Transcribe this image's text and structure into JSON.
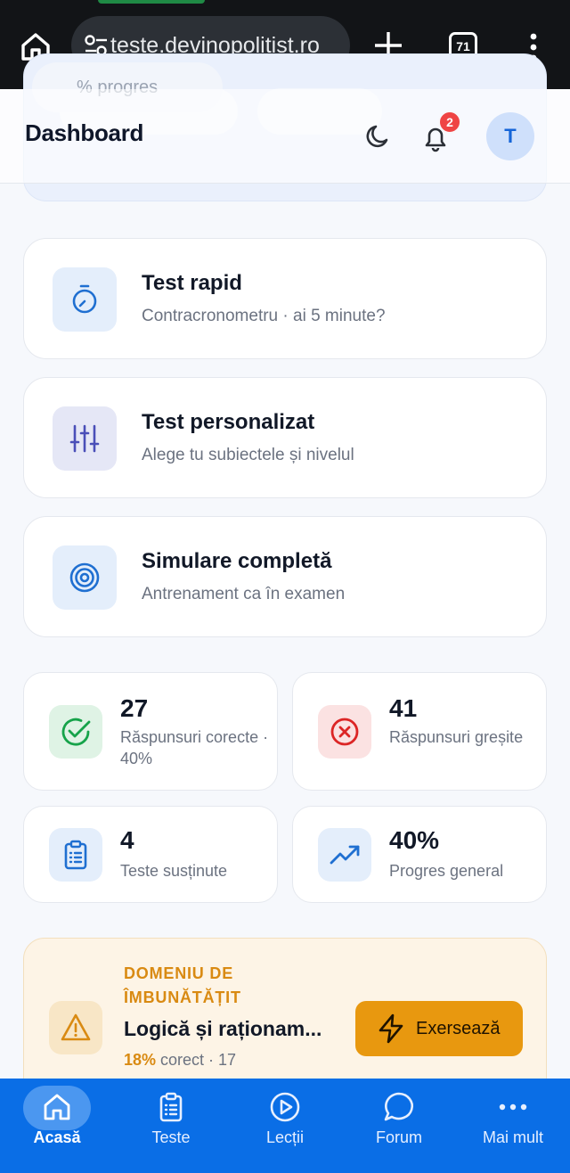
{
  "browser": {
    "url": "teste.devinopolitist.ro",
    "tab_count": "71"
  },
  "header": {
    "title": "Dashboard",
    "hero_progress_text": "% progres",
    "notification_count": "2",
    "avatar_initial": "T"
  },
  "actions": [
    {
      "title": "Test rapid",
      "subtitle": "Contracronometru · ai 5 minute?",
      "icon": "timer-icon",
      "color": "#1f6fd1"
    },
    {
      "title": "Test personalizat",
      "subtitle": "Alege tu subiectele și nivelul",
      "icon": "sliders-icon",
      "color": "#4a4fb8"
    },
    {
      "title": "Simulare completă",
      "subtitle": "Antrenament ca în examen",
      "icon": "target-icon",
      "color": "#1f6fd1"
    }
  ],
  "stats": [
    {
      "value": "27",
      "label": "Răspunsuri corecte · 40%",
      "icon": "check-circle-icon",
      "color": "#16a34a"
    },
    {
      "value": "41",
      "label": "Răspunsuri greșite",
      "icon": "x-circle-icon",
      "color": "#dc2626"
    },
    {
      "value": "4",
      "label": "Teste susținute",
      "icon": "clipboard-icon",
      "color": "#1f6fd1"
    },
    {
      "value": "40%",
      "label": "Progres general",
      "icon": "trending-up-icon",
      "color": "#1f6fd1"
    }
  ],
  "improve": {
    "kicker": "DOMENIU DE ÎMBUNĂTĂȚIT",
    "topic": "Logică și raționam...",
    "percent": "18%",
    "stats_rest": " corect · 17",
    "button_label": "Exersează",
    "icon": "warning-icon"
  },
  "nav": [
    {
      "label": "Acasă",
      "icon": "home-icon",
      "active": true
    },
    {
      "label": "Teste",
      "icon": "clipboard-icon"
    },
    {
      "label": "Lecții",
      "icon": "play-circle-icon"
    },
    {
      "label": "Forum",
      "icon": "chat-bubble-icon"
    },
    {
      "label": "Mai mult",
      "icon": "more-dots-icon"
    }
  ]
}
